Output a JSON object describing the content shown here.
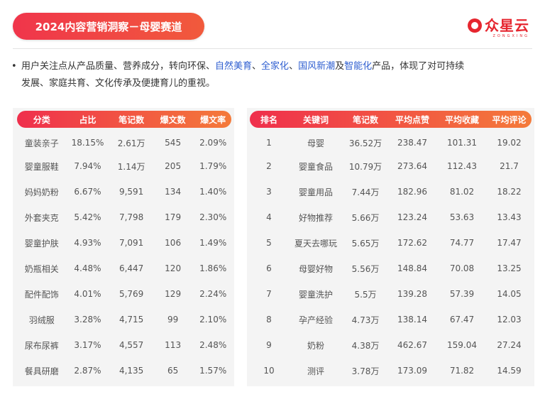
{
  "header": {
    "title": "2024内容营销洞察－母婴赛道",
    "logo_text": "众星云",
    "logo_sub": "ZONGXING"
  },
  "insight": {
    "bullet": "•",
    "p1": "用户关注点从产品质量、营养成分，转向环保、",
    "hl1": "自然美育",
    "p2": "、",
    "hl2": "全家化",
    "p3": "、",
    "hl3": "国风新潮",
    "p4": "及",
    "hl4": "智能化",
    "p5": "产品，体现了对可持续",
    "line2": "发展、家庭共育、文化传承及便捷育儿的重视。"
  },
  "category_table": {
    "headers": [
      "分类",
      "占比",
      "笔记数",
      "爆文数",
      "爆文率"
    ],
    "rows": [
      [
        "童装亲子",
        "18.15%",
        "2.61万",
        "545",
        "2.09%"
      ],
      [
        "婴童服鞋",
        "7.94%",
        "1.14万",
        "205",
        "1.79%"
      ],
      [
        "妈妈奶粉",
        "6.67%",
        "9,591",
        "134",
        "1.40%"
      ],
      [
        "外套夹克",
        "5.42%",
        "7,798",
        "179",
        "2.30%"
      ],
      [
        "婴童护肤",
        "4.93%",
        "7,091",
        "106",
        "1.49%"
      ],
      [
        "奶瓶相关",
        "4.48%",
        "6,447",
        "120",
        "1.86%"
      ],
      [
        "配件配饰",
        "4.01%",
        "5,769",
        "129",
        "2.24%"
      ],
      [
        "羽绒服",
        "3.28%",
        "4,715",
        "99",
        "2.10%"
      ],
      [
        "尿布尿裤",
        "3.17%",
        "4,557",
        "113",
        "2.48%"
      ],
      [
        "餐具研磨",
        "2.87%",
        "4,135",
        "65",
        "1.57%"
      ]
    ]
  },
  "keyword_table": {
    "headers": [
      "排名",
      "关键词",
      "笔记数",
      "平均点赞",
      "平均收藏",
      "平均评论"
    ],
    "rows": [
      [
        "1",
        "母婴",
        "36.52万",
        "238.47",
        "101.31",
        "19.02"
      ],
      [
        "2",
        "婴童食品",
        "10.79万",
        "273.64",
        "112.43",
        "21.7"
      ],
      [
        "3",
        "婴童用品",
        "7.44万",
        "182.96",
        "81.02",
        "18.22"
      ],
      [
        "4",
        "好物推荐",
        "5.66万",
        "123.24",
        "53.63",
        "13.43"
      ],
      [
        "5",
        "夏天去哪玩",
        "5.65万",
        "172.62",
        "74.77",
        "17.47"
      ],
      [
        "6",
        "母婴好物",
        "5.56万",
        "148.84",
        "70.08",
        "13.25"
      ],
      [
        "7",
        "婴童洗护",
        "5.5万",
        "139.28",
        "57.39",
        "14.05"
      ],
      [
        "8",
        "孕产经验",
        "4.73万",
        "138.14",
        "67.47",
        "12.03"
      ],
      [
        "9",
        "奶粉",
        "4.38万",
        "462.67",
        "159.04",
        "27.24"
      ],
      [
        "10",
        "测评",
        "3.78万",
        "173.09",
        "71.82",
        "14.59"
      ]
    ]
  },
  "colors": {
    "accent_red": "#ef2f4c",
    "accent_orange": "#f47a3a",
    "highlight_blue": "#2f5fd0",
    "panel_bg": "#f4f4f4"
  }
}
